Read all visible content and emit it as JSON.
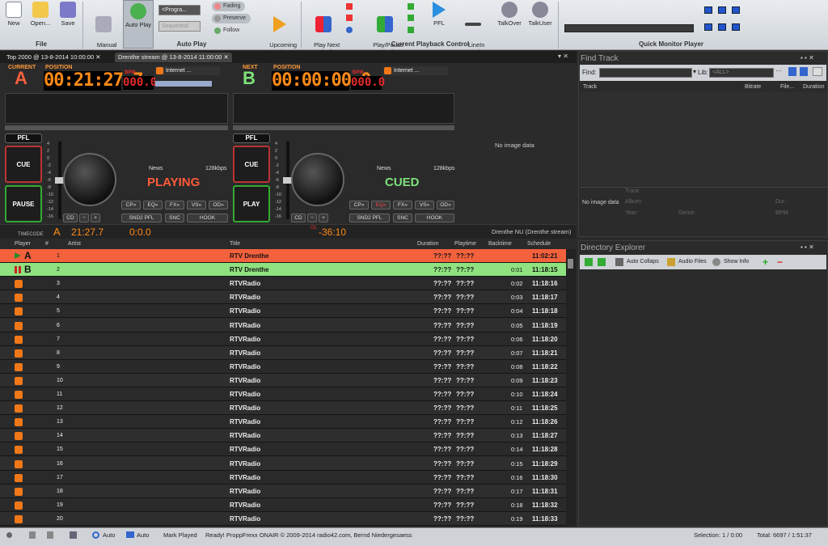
{
  "ribbon": {
    "file": {
      "new": "New",
      "open": "Open...",
      "save": "Save",
      "group": "File"
    },
    "autoplay": {
      "manual": "Manual\nLive-Assist",
      "auto": "Auto Play",
      "program_sel": "<Progra...",
      "sequential_sel": "Sequential",
      "fading": "Fading",
      "preserve": "Preserve",
      "follow": "Follow",
      "upcoming": "Upcoming\nOverlays",
      "group": "Auto Play"
    },
    "playback": {
      "play_next": "Play Next\nUse Fading",
      "play_pause": "Play/Pause\nUse Fading",
      "pfl": "PFL",
      "linein": "LineIn\nFeed",
      "talkover": "TalkOver",
      "talkuser": "TalkUser",
      "group": "Current Playback Control"
    },
    "monitor": {
      "group": "Quick Monitor Player"
    }
  },
  "tabs": [
    {
      "label": "Top 2000 @ 13-8-2014 10:00:00"
    },
    {
      "label": "Drenthe stream @ 13-8-2014 11:00:00"
    }
  ],
  "deckA": {
    "header": "CURRENT",
    "letter": "A",
    "pos_label": "POSITION",
    "position": "00:21:27.7",
    "bpm_label": "BPM",
    "bpm": "000.0",
    "source": "Internet ...",
    "pfl": "PFL",
    "cue": "CUE",
    "main": "PAUSE",
    "news": "News",
    "bitrate": "128kbps",
    "state": "PLAYING",
    "btns": [
      "CP»",
      "EQ»",
      "FX»",
      "VS»",
      "OD»",
      "SND2 PFL",
      "SNC",
      "HOOK"
    ],
    "cd": "CD",
    "minus": "−",
    "plus": "+",
    "scale": [
      "4",
      "2",
      "0",
      "-2",
      "-4",
      "-6",
      "-8",
      "-10",
      "-12",
      "-14",
      "-16"
    ]
  },
  "deckB": {
    "header": "NEXT",
    "letter": "B",
    "pos_label": "POSITION",
    "position": "00:00:00.0",
    "bpm_label": "BPM",
    "bpm": "000.0",
    "source": "Internet ...",
    "pfl": "PFL",
    "cue": "CUE",
    "main": "PLAY",
    "news": "News",
    "bitrate": "128kbps",
    "state": "CUED",
    "btns": [
      "CP»",
      "EQ»",
      "FX»",
      "VS»",
      "OD»",
      "SND2 PFL",
      "SNC",
      "HOOK"
    ],
    "cd": "CD",
    "minus": "−",
    "plus": "+",
    "scale": [
      "4",
      "2",
      "0",
      "-2",
      "-4",
      "-6",
      "-8",
      "-10",
      "-12",
      "-14",
      "-16"
    ]
  },
  "noimage": "No image data",
  "timecode": {
    "label": "TIMECODE",
    "letter": "A",
    "elapsed": "21:27.7",
    "intro": "0:0.0",
    "ol_label": "OL",
    "remain": "-36:10",
    "stream": "Drenthe NU (Drenthe stream)"
  },
  "playlist": {
    "headers": {
      "player": "Player",
      "num": "#",
      "artist": "Artist",
      "title": "Title",
      "duration": "Duration",
      "playtime": "Playtime",
      "backtime": "Backtime",
      "schedule": "Schedule"
    },
    "rows": [
      {
        "p": "A",
        "n": "1",
        "t": "RTV Drenthe",
        "d": "??:??",
        "pt": "??:??",
        "b": "",
        "s": "11:02:21"
      },
      {
        "p": "B",
        "n": "2",
        "t": "RTV Drenthe",
        "d": "??:??",
        "pt": "??:??",
        "b": "0:01",
        "s": "11:18:15"
      },
      {
        "p": "",
        "n": "3",
        "t": "RTVRadio",
        "d": "??:??",
        "pt": "??:??",
        "b": "0:02",
        "s": "11:18:16"
      },
      {
        "p": "",
        "n": "4",
        "t": "RTVRadio",
        "d": "??:??",
        "pt": "??:??",
        "b": "0:03",
        "s": "11:18:17"
      },
      {
        "p": "",
        "n": "5",
        "t": "RTVRadio",
        "d": "??:??",
        "pt": "??:??",
        "b": "0:04",
        "s": "11:18:18"
      },
      {
        "p": "",
        "n": "6",
        "t": "RTVRadio",
        "d": "??:??",
        "pt": "??:??",
        "b": "0:05",
        "s": "11:18:19"
      },
      {
        "p": "",
        "n": "7",
        "t": "RTVRadio",
        "d": "??:??",
        "pt": "??:??",
        "b": "0:06",
        "s": "11:18:20"
      },
      {
        "p": "",
        "n": "8",
        "t": "RTVRadio",
        "d": "??:??",
        "pt": "??:??",
        "b": "0:07",
        "s": "11:18:21"
      },
      {
        "p": "",
        "n": "9",
        "t": "RTVRadio",
        "d": "??:??",
        "pt": "??:??",
        "b": "0:08",
        "s": "11:18:22"
      },
      {
        "p": "",
        "n": "10",
        "t": "RTVRadio",
        "d": "??:??",
        "pt": "??:??",
        "b": "0:09",
        "s": "11:18:23"
      },
      {
        "p": "",
        "n": "11",
        "t": "RTVRadio",
        "d": "??:??",
        "pt": "??:??",
        "b": "0:10",
        "s": "11:18:24"
      },
      {
        "p": "",
        "n": "12",
        "t": "RTVRadio",
        "d": "??:??",
        "pt": "??:??",
        "b": "0:11",
        "s": "11:18:25"
      },
      {
        "p": "",
        "n": "13",
        "t": "RTVRadio",
        "d": "??:??",
        "pt": "??:??",
        "b": "0:12",
        "s": "11:18:26"
      },
      {
        "p": "",
        "n": "14",
        "t": "RTVRadio",
        "d": "??:??",
        "pt": "??:??",
        "b": "0:13",
        "s": "11:18:27"
      },
      {
        "p": "",
        "n": "15",
        "t": "RTVRadio",
        "d": "??:??",
        "pt": "??:??",
        "b": "0:14",
        "s": "11:18:28"
      },
      {
        "p": "",
        "n": "16",
        "t": "RTVRadio",
        "d": "??:??",
        "pt": "??:??",
        "b": "0:15",
        "s": "11:18:29"
      },
      {
        "p": "",
        "n": "17",
        "t": "RTVRadio",
        "d": "??:??",
        "pt": "??:??",
        "b": "0:16",
        "s": "11:18:30"
      },
      {
        "p": "",
        "n": "18",
        "t": "RTVRadio",
        "d": "??:??",
        "pt": "??:??",
        "b": "0:17",
        "s": "11:18:31"
      },
      {
        "p": "",
        "n": "19",
        "t": "RTVRadio",
        "d": "??:??",
        "pt": "??:??",
        "b": "0:18",
        "s": "11:18:32"
      },
      {
        "p": "",
        "n": "20",
        "t": "RTVRadio",
        "d": "??:??",
        "pt": "??:??",
        "b": "0:19",
        "s": "11:18:33"
      }
    ]
  },
  "findtrack": {
    "title": "Find Track",
    "find_label": "Find:",
    "lib_label": "Lib:",
    "lib_value": "<ALL>",
    "cols": {
      "track": "Track",
      "bitrate": "Bitrate",
      "file": "File...",
      "duration": "Duration"
    },
    "noimage": "No image data",
    "meta": {
      "track": "Track:",
      "album": "Album:",
      "year": "Year:",
      "genre": "Genre:",
      "dur": "Dur.:",
      "bpm": "BPM:"
    }
  },
  "direxplorer": {
    "title": "Directory Explorer",
    "auto_collaps": "Auto Collaps",
    "audio_files": "Audio Files",
    "show_info": "Show Info"
  },
  "status": {
    "auto1": "Auto",
    "auto2": "Auto",
    "mark_played": "Mark Played",
    "message": "Ready!  ProppFrexx ONAIR © 2009-2014 radio42.com, Bernd Niedergesaess",
    "selection": "Selection: 1 / 0:00",
    "total": "Total: 6697 / 1:51:37"
  },
  "colors": {
    "rowA": "#f4613d",
    "rowB": "#8fe27f",
    "orange": "#ff8a18",
    "playing": "#ff5a3a",
    "cued": "#7ee27a"
  }
}
